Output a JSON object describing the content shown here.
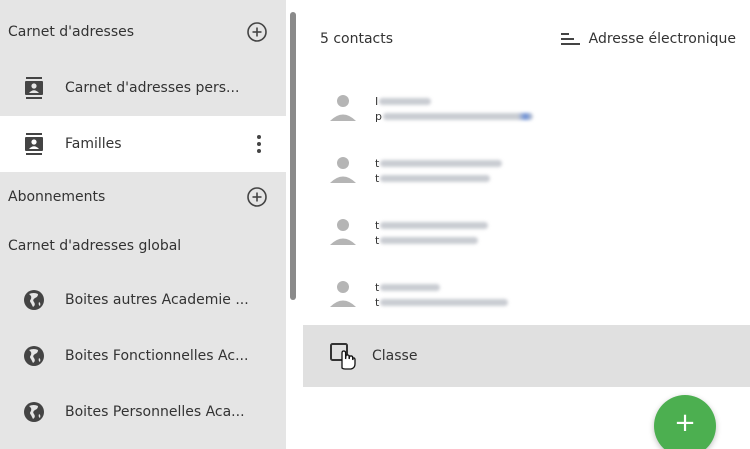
{
  "sidebar": {
    "sections": [
      {
        "label": "Carnet d'adresses",
        "has_add": true
      },
      {
        "label": "Abonnements",
        "has_add": true
      },
      {
        "label": "Carnet d'adresses global",
        "has_add": false
      }
    ],
    "addressbooks": [
      {
        "label": "Carnet d'adresses pers...",
        "icon": "addressbook-icon",
        "selected": false
      },
      {
        "label": "Familles",
        "icon": "addressbook-icon",
        "selected": true
      }
    ],
    "global_items": [
      {
        "label": "Boites autres Academie ...",
        "icon": "globe-icon"
      },
      {
        "label": "Boites Fonctionnelles Ac...",
        "icon": "globe-icon"
      },
      {
        "label": "Boites Personnelles Aca...",
        "icon": "globe-icon"
      }
    ]
  },
  "main": {
    "count": "5 contacts",
    "sort_label": "Adresse électronique",
    "contacts": [
      {
        "name": "I",
        "email": "p"
      },
      {
        "name": "t",
        "email": "t"
      },
      {
        "name": "t",
        "email": "t"
      },
      {
        "name": "t",
        "email": "t"
      }
    ],
    "group": {
      "label": "Classe",
      "icon": "group-pointer-icon"
    },
    "fab_label": "+"
  },
  "colors": {
    "sidebar_bg": "#e5e5e5",
    "selected_bg": "#ffffff",
    "group_bg": "#e0e0e0",
    "fab": "#4caf50",
    "icon": "#444444"
  }
}
